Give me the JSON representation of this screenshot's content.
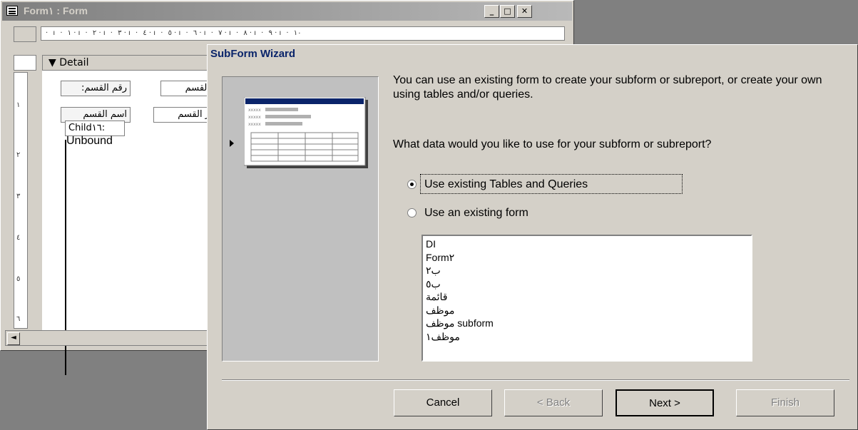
{
  "background_window": {
    "title": "Form١ : Form",
    "ruler_marks": "· ı · ١ · ı · ٢ · ı · ٣ · ı · ٤ · ı · ٥ · ı · ٦ · ı · ٧ · ı · ٨ · ı · ٩ · ı · ١٠",
    "vertical_ruler": [
      "١",
      "٢",
      "٣",
      "٤",
      "٥",
      "٦"
    ],
    "section_label": "Detail",
    "controls": {
      "label1": "رقم القسم:",
      "field1": "القسم",
      "label2": "اسم القسم",
      "field2": "ر القسم",
      "child_label": "Child١٦:",
      "unbound": "Unbound"
    },
    "caption_buttons": [
      "_",
      "□",
      "✕"
    ]
  },
  "wizard": {
    "title": "SubForm Wizard",
    "intro": "You can use an existing form to create your subform or subreport, or create your own using tables and/or queries.",
    "question": "What data would you like to use for your subform or subreport?",
    "options": [
      {
        "label": "Use existing Tables and Queries",
        "selected": true
      },
      {
        "label": "Use an existing form",
        "selected": false
      }
    ],
    "form_list": [
      "DI",
      "Form٢",
      "ب٢",
      "ب٥",
      "قائمة",
      "موظف",
      "موظف subform",
      "موظف١"
    ],
    "buttons": {
      "cancel": "Cancel",
      "back": "< Back",
      "next": "Next >",
      "finish": "Finish"
    }
  },
  "colors": {
    "dialog_bg": "#d4d0c8",
    "title_text": "#0a246a",
    "inactive_title": "#7f7f7f"
  }
}
